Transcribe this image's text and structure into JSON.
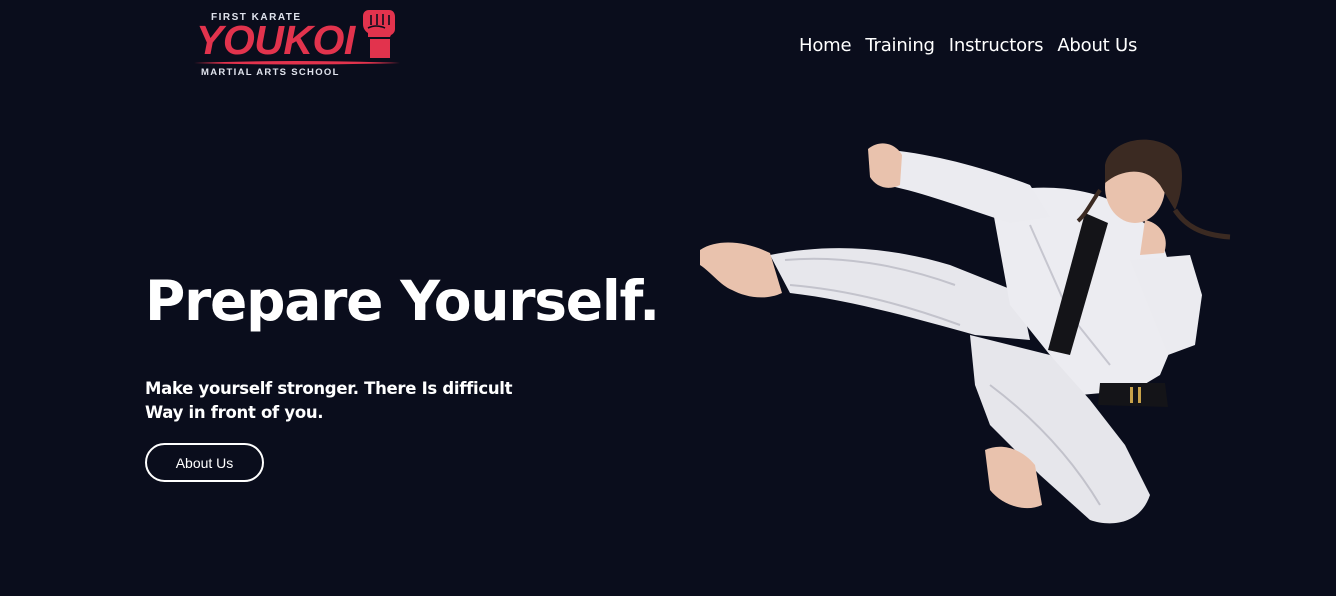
{
  "logo": {
    "top_text": "FIRST KARATE",
    "main_text": "YOUKOI",
    "bottom_text": "MARTIAL ARTS SCHOOL",
    "icon": "raised-fist-icon",
    "brand_color": "#e2334d"
  },
  "nav": {
    "items": [
      {
        "label": "Home"
      },
      {
        "label": "Training"
      },
      {
        "label": "Instructors"
      },
      {
        "label": "About Us"
      }
    ]
  },
  "hero": {
    "title": "Prepare Yourself.",
    "subtitle": "Make yourself stronger. There Is difficult Way in front of you.",
    "button_label": "About Us",
    "image": "karate-woman-flying-kick"
  },
  "colors": {
    "background": "#0a0d1c",
    "text": "#ffffff"
  }
}
